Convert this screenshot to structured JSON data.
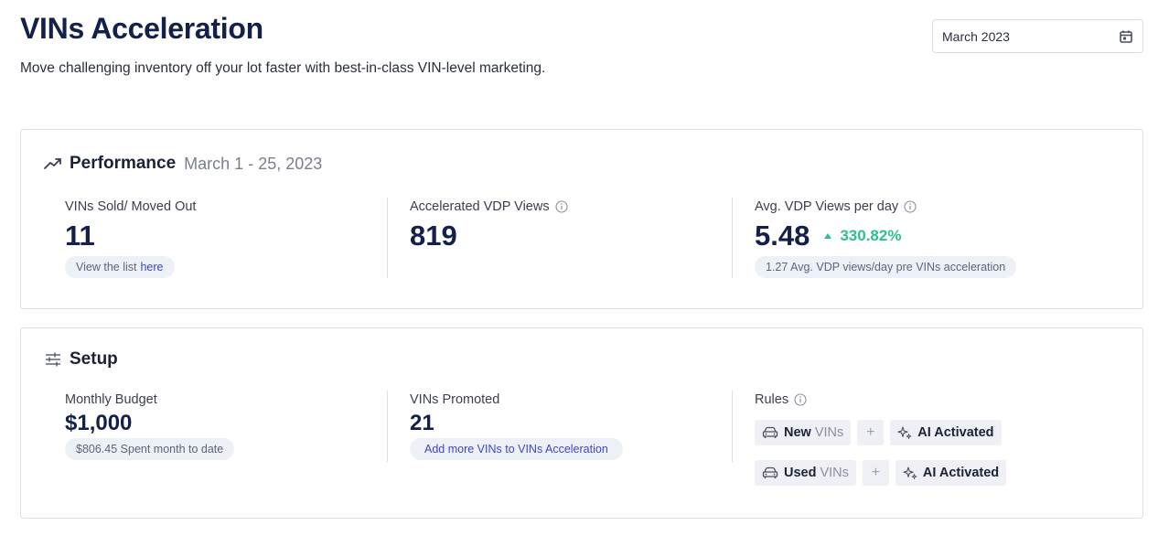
{
  "header": {
    "title": "VINs Acceleration",
    "subtitle": "Move challenging inventory off your lot faster with best-in-class VIN-level marketing."
  },
  "date_picker": {
    "value": "March 2023",
    "icon": "calendar-icon"
  },
  "performance": {
    "icon": "trending-up-icon",
    "title": "Performance",
    "range": "March 1 - 25, 2023",
    "vins_sold": {
      "label": "VINs Sold/ Moved Out",
      "value": "11",
      "pill_text": "View the list",
      "pill_link": "here"
    },
    "accelerated_views": {
      "label": "Accelerated VDP Views",
      "value": "819"
    },
    "avg_views": {
      "label": "Avg. VDP Views per day",
      "value": "5.48",
      "delta": "330.82%",
      "pill_text": "1.27 Avg. VDP views/day pre VINs acceleration"
    }
  },
  "setup": {
    "icon": "sliders-icon",
    "title": "Setup",
    "budget": {
      "label": "Monthly Budget",
      "value": "$1,000",
      "pill_text": "$806.45 Spent month to date"
    },
    "promoted": {
      "label": "VINs Promoted",
      "value": "21",
      "pill_link": "Add more VINs to VINs Acceleration"
    },
    "rules": {
      "label": "Rules",
      "items": [
        {
          "type_bold": "New",
          "type_rest": "VINs",
          "plus": "+",
          "ai": "AI Activated"
        },
        {
          "type_bold": "Used",
          "type_rest": "VINs",
          "plus": "+",
          "ai": "AI Activated"
        }
      ]
    }
  },
  "colors": {
    "title": "#13204a",
    "positive": "#2fbf8c",
    "link": "#3b48c4"
  }
}
